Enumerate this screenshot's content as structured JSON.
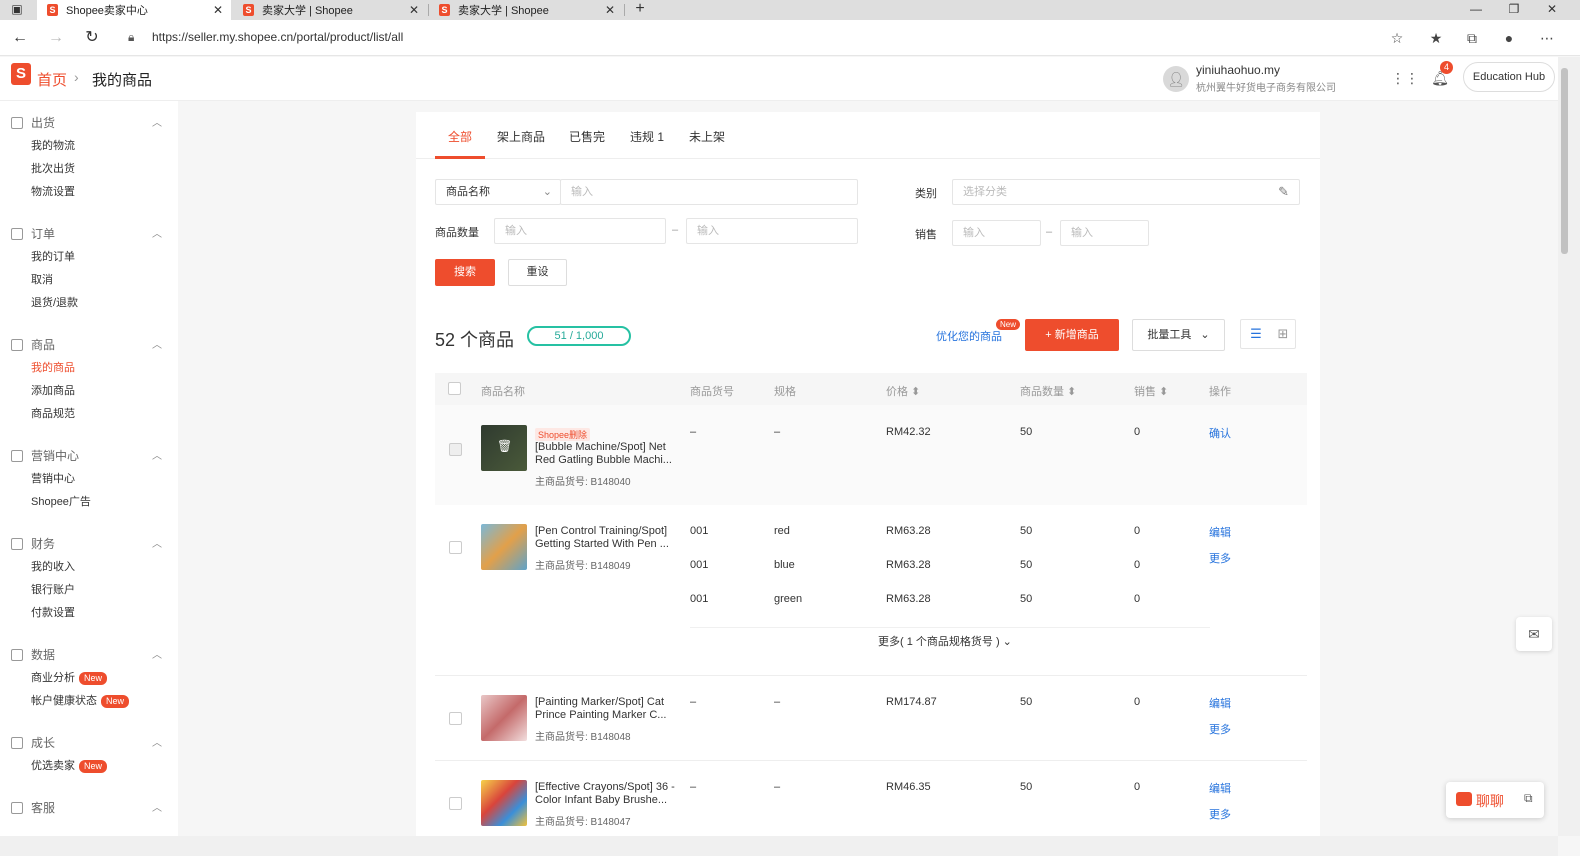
{
  "browser": {
    "tabs": [
      {
        "title": "Shopee卖家中心",
        "active": true
      },
      {
        "title": "卖家大学 | Shopee",
        "active": false
      },
      {
        "title": "卖家大学 | Shopee",
        "active": false
      }
    ],
    "new_tab": "+",
    "url": "https://seller.my.shopee.cn/portal/product/list/all"
  },
  "header": {
    "breadcrumb_home": "首页",
    "breadcrumb_current": "我的商品",
    "username": "yiniuhaohuo.my",
    "company": "杭州翼牛好货电子商务有限公司",
    "notification_count": "4",
    "education_hub": "Education Hub"
  },
  "sidebar": [
    {
      "title": "出货",
      "items": [
        {
          "label": "我的物流"
        },
        {
          "label": "批次出货"
        },
        {
          "label": "物流设置"
        }
      ]
    },
    {
      "title": "订单",
      "items": [
        {
          "label": "我的订单"
        },
        {
          "label": "取消"
        },
        {
          "label": "退货/退款"
        }
      ]
    },
    {
      "title": "商品",
      "items": [
        {
          "label": "我的商品",
          "active": true
        },
        {
          "label": "添加商品"
        },
        {
          "label": "商品规范"
        }
      ]
    },
    {
      "title": "营销中心",
      "items": [
        {
          "label": "营销中心"
        },
        {
          "label": "Shopee广告"
        }
      ]
    },
    {
      "title": "财务",
      "items": [
        {
          "label": "我的收入"
        },
        {
          "label": "银行账户"
        },
        {
          "label": "付款设置"
        }
      ]
    },
    {
      "title": "数据",
      "items": [
        {
          "label": "商业分析",
          "badge": "New"
        },
        {
          "label": "帐户健康状态",
          "badge": "New"
        }
      ]
    },
    {
      "title": "成长",
      "items": [
        {
          "label": "优选卖家",
          "badge": "New"
        }
      ]
    },
    {
      "title": "客服",
      "items": []
    }
  ],
  "main": {
    "tabs": [
      "全部",
      "架上商品",
      "已售完",
      "违规 1",
      "未上架"
    ],
    "filters": {
      "name_select": "商品名称",
      "input_placeholder": "输入",
      "category_label": "类别",
      "category_placeholder": "选择分类",
      "quantity_label": "商品数量",
      "sales_label": "销售",
      "dash": "–",
      "search_button": "搜索",
      "reset_button": "重设"
    },
    "count_title": "52 个商品",
    "quota": "51 / 1,000",
    "optimize_link": "优化您的商品",
    "optimize_badge": "New",
    "add_button": "+ 新增商品",
    "batch_tools": "批量工具",
    "table_headers": {
      "name": "商品名称",
      "sku": "商品货号",
      "variation": "规格",
      "price": "价格 ⬍",
      "stock": "商品数量 ⬍",
      "sales": "销售 ⬍",
      "actions": "操作"
    },
    "products": [
      {
        "deleted_tag": "Shopee删除",
        "name": "[Bubble Machine/Spot] Net Red Gatling Bubble Machi...",
        "parent_sku": "主商品货号: B148040",
        "variants": [
          {
            "sku": "–",
            "variation": "–",
            "price": "RM42.32",
            "stock": "50",
            "sales": "0"
          }
        ],
        "actions": [
          "确认"
        ]
      },
      {
        "name": "[Pen Control Training/Spot] Getting Started With Pen ...",
        "parent_sku": "主商品货号: B148049",
        "variants": [
          {
            "sku": "001",
            "variation": "red",
            "price": "RM63.28",
            "stock": "50",
            "sales": "0"
          },
          {
            "sku": "001",
            "variation": "blue",
            "price": "RM63.28",
            "stock": "50",
            "sales": "0"
          },
          {
            "sku": "001",
            "variation": "green",
            "price": "RM63.28",
            "stock": "50",
            "sales": "0"
          }
        ],
        "more_variants": "更多( 1 个商品规格货号 ) ⌄",
        "actions": [
          "编辑",
          "更多"
        ]
      },
      {
        "name": "[Painting Marker/Spot] Cat Prince Painting Marker C...",
        "parent_sku": "主商品货号: B148048",
        "variants": [
          {
            "sku": "–",
            "variation": "–",
            "price": "RM174.87",
            "stock": "50",
            "sales": "0"
          }
        ],
        "actions": [
          "编辑",
          "更多"
        ]
      },
      {
        "name": "[Effective Crayons/Spot] 36 -Color Infant Baby Brushe...",
        "parent_sku": "主商品货号: B148047",
        "variants": [
          {
            "sku": "–",
            "variation": "–",
            "price": "RM46.35",
            "stock": "50",
            "sales": "0"
          }
        ],
        "actions": [
          "编辑",
          "更多"
        ]
      }
    ]
  },
  "chat": {
    "label": "聊聊"
  },
  "colors": {
    "brand": "#ee4d2d",
    "link": "#2673dd",
    "quota": "#26c1a3"
  }
}
